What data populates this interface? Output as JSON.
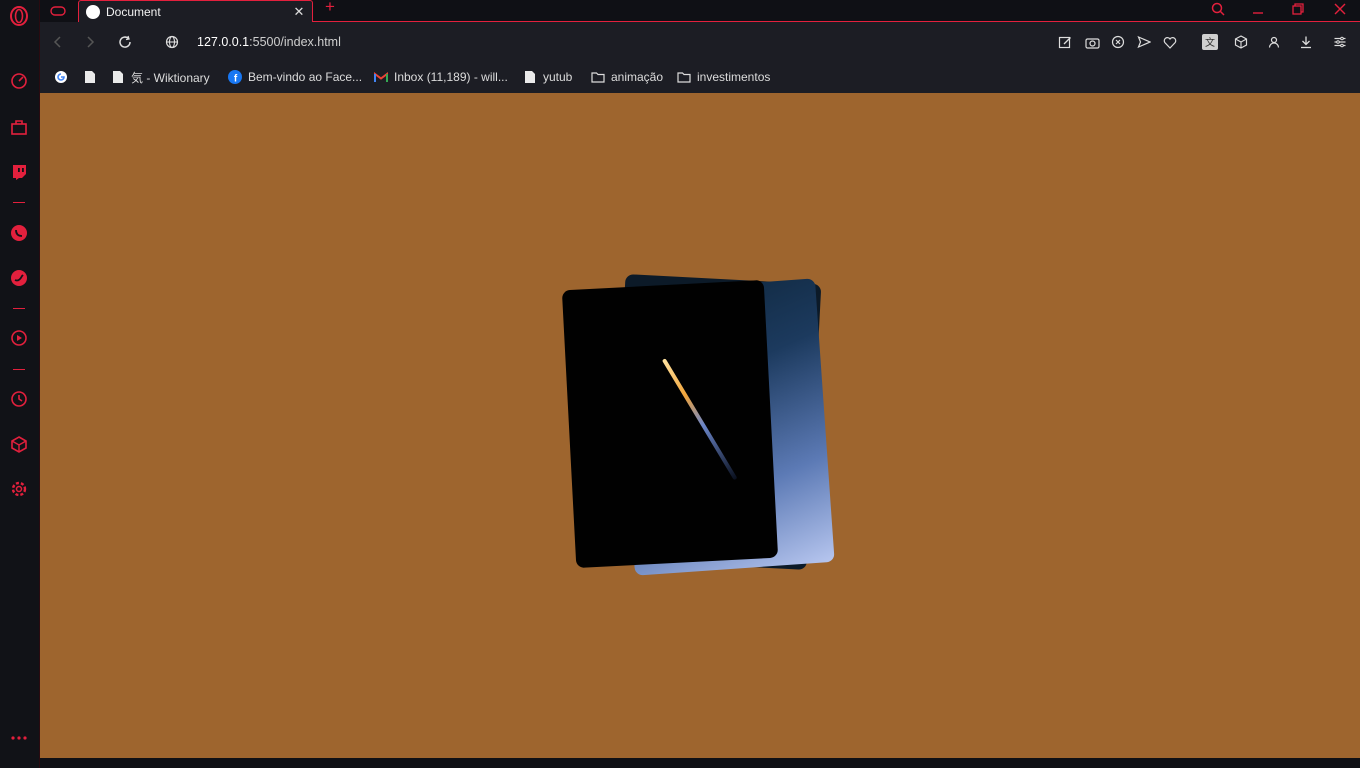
{
  "colors": {
    "accent": "#e3203d",
    "page_background": "#9e652e",
    "chrome_background": "#1c1d24"
  },
  "sidebar": {
    "items": [
      {
        "name": "opera-logo-icon"
      },
      {
        "name": "speed-dial-icon"
      },
      {
        "name": "shopping-icon"
      },
      {
        "name": "twitch-icon"
      },
      {
        "name": "whatsapp-icon"
      },
      {
        "name": "twitter-icon"
      },
      {
        "name": "player-icon"
      },
      {
        "name": "history-icon"
      },
      {
        "name": "extensions-icon"
      },
      {
        "name": "settings-icon"
      },
      {
        "name": "more-icon"
      }
    ]
  },
  "tabs": {
    "items": [
      {
        "title": "Document",
        "active": true
      }
    ],
    "new_tab_label": "+"
  },
  "address_bar": {
    "host": "127.0.0.1",
    "path": ":5500/index.html"
  },
  "bookmarks": [
    {
      "label": "",
      "icon": "google-icon"
    },
    {
      "label": "",
      "icon": "page-icon"
    },
    {
      "label": "気 - Wiktionary",
      "icon": "page-icon"
    },
    {
      "label": "Bem-vindo ao Face...",
      "icon": "facebook-icon"
    },
    {
      "label": "Inbox (11,189) - will...",
      "icon": "gmail-icon"
    },
    {
      "label": "yutub",
      "icon": "page-icon"
    },
    {
      "label": "animação",
      "icon": "folder-icon"
    },
    {
      "label": "investimentos",
      "icon": "folder-icon"
    }
  ]
}
